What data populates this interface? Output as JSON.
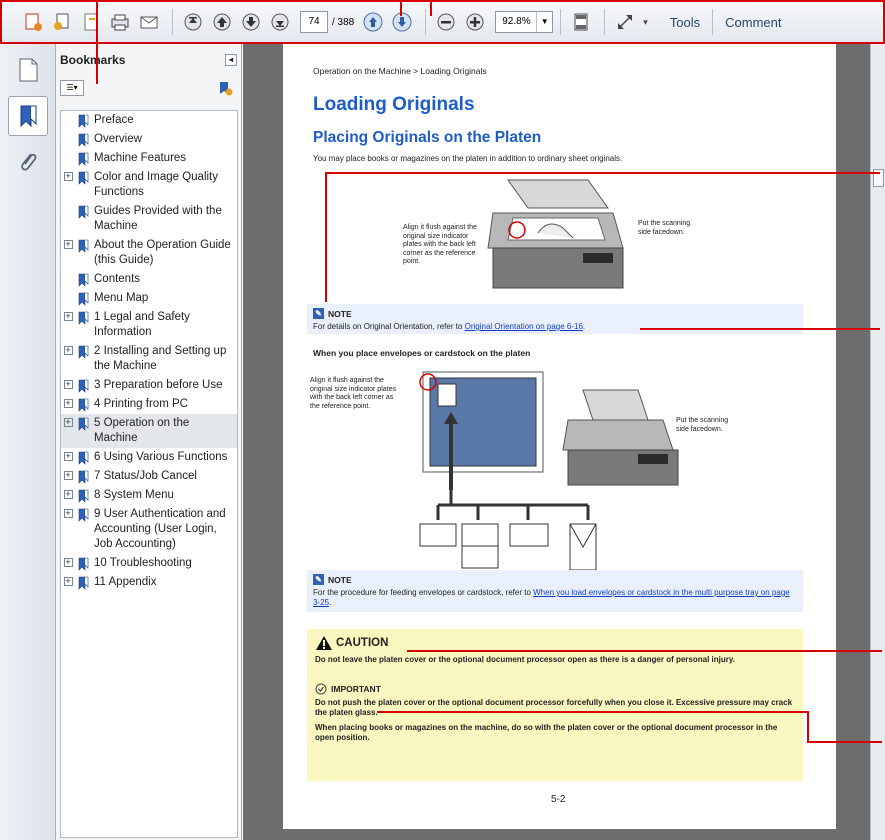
{
  "toolbar": {
    "page_current": "74",
    "page_total": "/ 388",
    "zoom": "92.8%",
    "tools_label": "Tools",
    "comment_label": "Comment"
  },
  "panel": {
    "title": "Bookmarks",
    "items": [
      {
        "label": "Preface",
        "expand": ""
      },
      {
        "label": "Overview",
        "expand": ""
      },
      {
        "label": "Machine Features",
        "expand": ""
      },
      {
        "label": "Color and Image Quality Functions",
        "expand": "+"
      },
      {
        "label": "Guides Provided with the Machine",
        "expand": ""
      },
      {
        "label": "About the Operation Guide (this Guide)",
        "expand": "+"
      },
      {
        "label": "Contents",
        "expand": ""
      },
      {
        "label": "Menu Map",
        "expand": ""
      },
      {
        "label": "1 Legal and Safety Information",
        "expand": "+"
      },
      {
        "label": "2 Installing and Setting up the Machine",
        "expand": "+"
      },
      {
        "label": "3 Preparation before Use",
        "expand": "+"
      },
      {
        "label": "4 Printing from PC",
        "expand": "+"
      },
      {
        "label": "5 Operation on the Machine",
        "expand": "+"
      },
      {
        "label": "6 Using Various Functions",
        "expand": "+"
      },
      {
        "label": "7 Status/Job Cancel",
        "expand": "+"
      },
      {
        "label": "8 System Menu",
        "expand": "+"
      },
      {
        "label": "9 User Authentication and Accounting (User Login, Job Accounting)",
        "expand": "+"
      },
      {
        "label": "10 Troubleshooting",
        "expand": "+"
      },
      {
        "label": "11 Appendix",
        "expand": "+"
      }
    ]
  },
  "page": {
    "breadcrumb": "Operation on the Machine > Loading Originals",
    "h1": "Loading Originals",
    "h2": "Placing Originals on the Platen",
    "intro": "You may place books or magazines on the platen in addition to ordinary sheet originals.",
    "illus1_left": "Align it flush against the original size indicator plates with the back left corner as the reference point.",
    "illus1_right": "Put the scanning side facedown.",
    "note1_title": "NOTE",
    "note1_text": "For details on Original Orientation, refer to ",
    "note1_link": "Original Orientation on page 6-16",
    "note1_end": ".",
    "subhead": "When you place envelopes or cardstock on the platen",
    "illus2_left": "Align it flush against the original size indicator plates with the back left corner as the reference point.",
    "illus2_right": "Put the scanning side facedown.",
    "note2_title": "NOTE",
    "note2_text": "For the procedure for feeding envelopes or cardstock, refer to ",
    "note2_link": "When you load envelopes or cardstock in the multi purpose tray on page 3-25",
    "note2_end": ".",
    "caution_title": "CAUTION",
    "caution_text": "Do not leave the platen cover or the optional document processor open as there is a danger of personal injury.",
    "important_title": "IMPORTANT",
    "important_p1": "Do not push the platen cover or the optional document processor forcefully when you close it. Excessive pressure may crack the platen glass.",
    "important_p2": "When placing books or magazines on the machine, do so with the platen cover or the optional document processor in the open position.",
    "page_number": "5-2"
  }
}
